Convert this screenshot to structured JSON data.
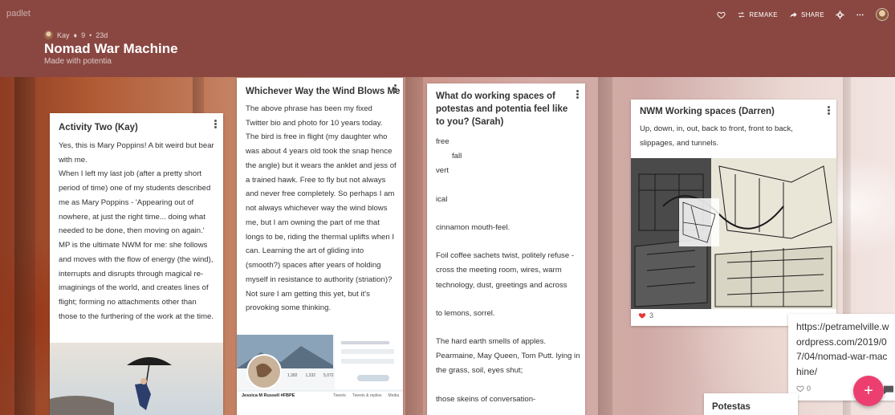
{
  "app": {
    "brand": "padlet"
  },
  "header": {
    "author": "Kay",
    "likes": "9",
    "age": "23d",
    "title": "Nomad War Machine",
    "subtitle": "Made with potentia",
    "remake_label": "REMAKE",
    "share_label": "SHARE"
  },
  "cards": {
    "activity_two": {
      "title": "Activity Two (Kay)",
      "paragraphs": [
        "Yes, this is Mary Poppins!  A bit weird but bear with me.",
        "When I left my last job (after a pretty short period of time) one of my students described me as Mary Poppins - 'Appearing out of nowhere, at just the right time... doing what needed to be done, then moving on again.' MP is the ultimate NWM for me: she follows and moves with the flow of energy (the wind), interrupts and disrupts through magical re-imaginings of the world, and creates lines of flight; forming no attachments other than those to the furthering of the work at the time."
      ]
    },
    "wind": {
      "title": "Whichever Way the Wind Blows Me",
      "body": "The above phrase has been my fixed Twitter bio and photo for 10 years today. The bird is free in flight (my daughter who was about 4 years old took the snap hence the angle) but it wears the anklet and jess of a trained hawk.  Free to fly but not always and never free completely.  So perhaps I am not always whichever way the wind blows me, but I am owning the part of me that longs to be,  riding the thermal uplifts when I can. Learning the art of gliding into (smooth?) spaces after years of holding myself in resistance to authority (striation)?  Not sure I am getting this yet, but it's provoking some thinking.",
      "screenshot": {
        "profile_name": "Jessica M Russell #FBPE",
        "tabs": [
          "Tweets",
          "Tweets & replies",
          "Media"
        ],
        "stats": [
          "1,382",
          "1,332",
          "5,072"
        ]
      }
    },
    "working_spaces": {
      "title": "What do working spaces of potestas and potentia feel like to you? (Sarah)",
      "lines": [
        "free",
        "fall",
        "vert",
        "",
        "ical",
        "",
        "cinnamon mouth-feel.",
        "",
        "Foil coffee sachets twist, politely refuse - cross the meeting room, wires, warm",
        "technology, dust, greetings and across",
        "",
        "to lemons, sorrel.",
        "",
        "The hard earth smells of apples. Pearmaine, May Queen, Tom Putt. lying in the grass, soil, eyes shut;",
        "",
        "those skeins of conversation-"
      ]
    },
    "nwm_darren": {
      "title": "NWM Working spaces (Darren)",
      "body": "Up, down, in, out, back to front, front to back, slippages, and tunnels.",
      "likes": "3"
    },
    "link": {
      "url": "https://petramelville.wordpress.com/2019/07/04/nomad-war-machine/",
      "comments": "0"
    },
    "potestas": {
      "title": "Potestas"
    }
  },
  "colors": {
    "header_bg": "#8a4741",
    "fab": "#ec3f6f",
    "like_heart": "#e53935"
  }
}
